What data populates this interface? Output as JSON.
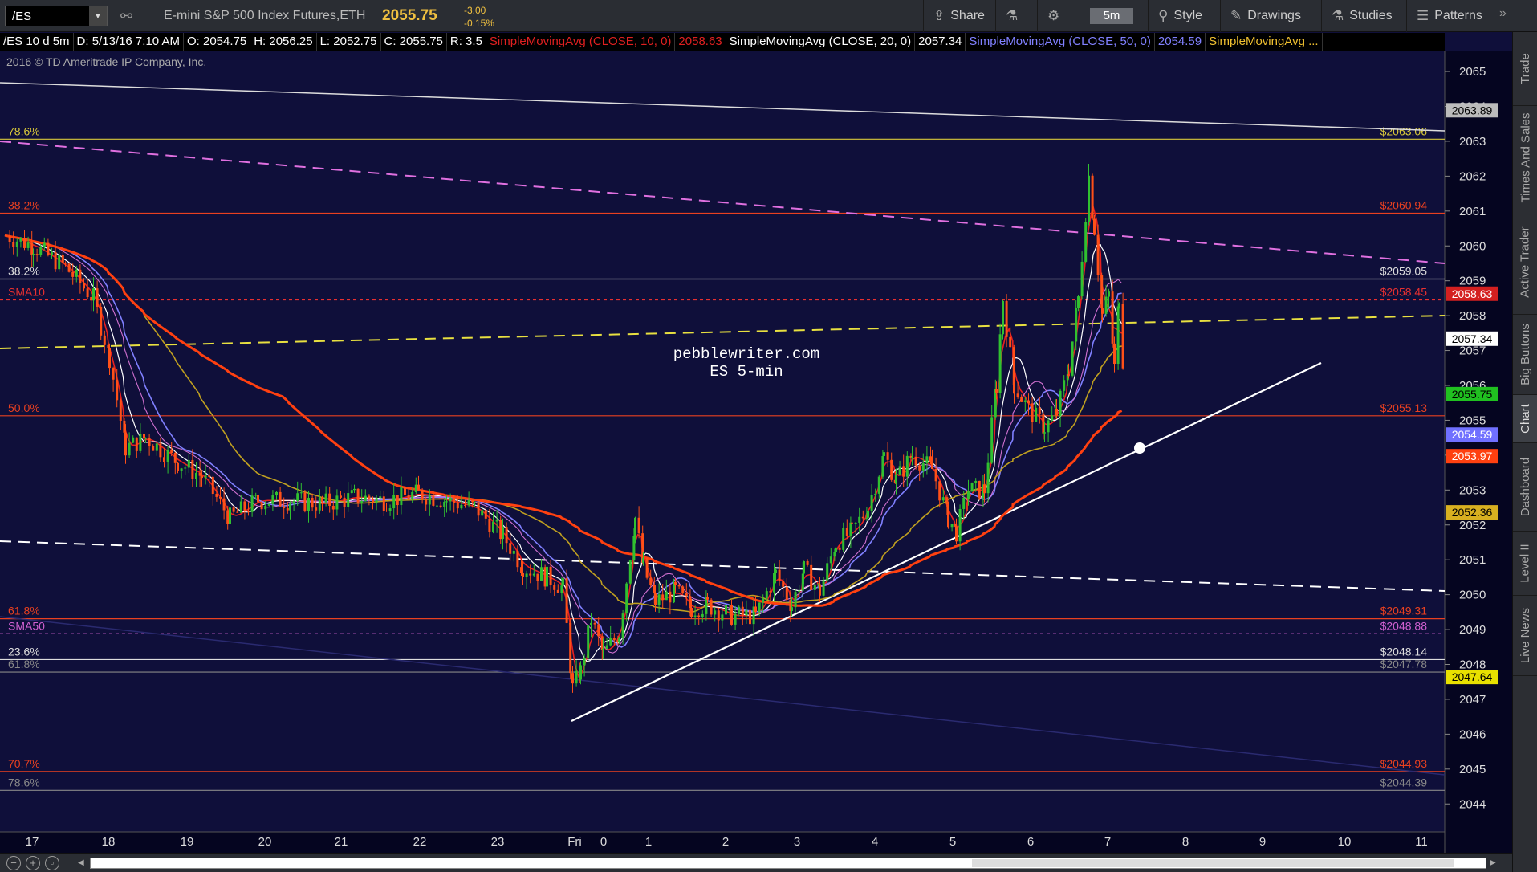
{
  "toolbar": {
    "symbol": "/ES",
    "instrument": "E-mini S&P 500 Index Futures,ETH",
    "price": "2055.75",
    "change": "-3.00",
    "change_pct": "-0.15%",
    "share": "Share",
    "timeframe": "5m",
    "style": "Style",
    "drawings": "Drawings",
    "studies": "Studies",
    "patterns": "Patterns"
  },
  "study_bar": {
    "info": "/ES 10 d 5m",
    "date": "D: 5/13/16 7:10 AM",
    "open": "O: 2054.75",
    "high": "H: 2056.25",
    "low": "L: 2052.75",
    "close": "C: 2055.75",
    "range": "R: 3.5",
    "sma10": "SimpleMovingAvg (CLOSE, 10, 0)",
    "sma10_val": "2058.63",
    "sma20": "SimpleMovingAvg (CLOSE, 20, 0)",
    "sma20_val": "2057.34",
    "sma50": "SimpleMovingAvg (CLOSE, 50, 0)",
    "sma50_val": "2054.59",
    "sma_more": "SimpleMovingAvg ..."
  },
  "copyright": "2016 © TD Ameritrade IP Company, Inc.",
  "watermark": {
    "line1": "pebblewriter.com",
    "line2": "ES 5-min"
  },
  "colors": {
    "background": "#0f0f3a",
    "sma10": "#e82020",
    "sma20": "#ffffff",
    "sma50": "#8080ff",
    "sma200": "#ff4010",
    "fib_yellow": "#d8c83a",
    "up_candle": "#30c030",
    "down_candle": "#ff5018"
  },
  "sidebar": {
    "tabs": [
      "Trade",
      "Times And Sales",
      "Active Trader",
      "Big Buttons",
      "Chart",
      "Dashboard",
      "Level II",
      "Live News"
    ],
    "active": "Chart"
  },
  "price_axis": {
    "min": 2043.2,
    "max": 2065.6,
    "ticks": [
      2044,
      2045,
      2046,
      2047,
      2048,
      2049,
      2050,
      2051,
      2052,
      2053,
      2054,
      2055,
      2056,
      2057,
      2058,
      2059,
      2060,
      2061,
      2062,
      2063,
      2064,
      2065
    ]
  },
  "time_axis": [
    "17",
    "18",
    "19",
    "20",
    "21",
    "22",
    "23",
    "Fri",
    "0",
    "1",
    "2",
    "3",
    "4",
    "5",
    "6",
    "7",
    "8",
    "9",
    "10",
    "11"
  ],
  "price_tags": [
    {
      "label": "2063.89",
      "price": 2063.89,
      "bg": "#bcbcbc",
      "fg": "#000"
    },
    {
      "label": "2058.63",
      "price": 2058.63,
      "bg": "#d42020",
      "fg": "#fff"
    },
    {
      "label": "2057.34",
      "price": 2057.34,
      "bg": "#ffffff",
      "fg": "#000"
    },
    {
      "label": "2055.75",
      "price": 2055.75,
      "bg": "#20c020",
      "fg": "#000"
    },
    {
      "label": "2054.59",
      "price": 2054.59,
      "bg": "#7070ff",
      "fg": "#fff"
    },
    {
      "label": "2053.97",
      "price": 2053.97,
      "bg": "#ff4010",
      "fg": "#fff"
    },
    {
      "label": "2052.36",
      "price": 2052.36,
      "bg": "#d8b020",
      "fg": "#000"
    },
    {
      "label": "2047.64",
      "price": 2047.64,
      "bg": "#e8e000",
      "fg": "#000"
    }
  ],
  "levels": [
    {
      "left": "78.6%",
      "right": "$2063.06",
      "price": 2063.06,
      "color": "#d8c83a",
      "dash": ""
    },
    {
      "left": "38.2%",
      "right": "$2060.94",
      "price": 2060.94,
      "color": "#e84020",
      "dash": ""
    },
    {
      "left": "38.2%",
      "right": "$2059.05",
      "price": 2059.05,
      "color": "#dddddd",
      "dash": ""
    },
    {
      "left": "SMA10",
      "right": "$2058.45",
      "price": 2058.45,
      "color": "#e83030",
      "dash": "4,4"
    },
    {
      "left": "50.0%",
      "right": "$2055.13",
      "price": 2055.13,
      "color": "#e84020",
      "dash": ""
    },
    {
      "left": "61.8%",
      "right": "$2049.31",
      "price": 2049.31,
      "color": "#e84020",
      "dash": ""
    },
    {
      "left": "SMA50",
      "right": "$2048.88",
      "price": 2048.88,
      "color": "#d060d0",
      "dash": "4,4"
    },
    {
      "left": "23.6%",
      "right": "$2048.14",
      "price": 2048.14,
      "color": "#dddddd",
      "dash": ""
    },
    {
      "left": "61.8%",
      "right": "$2047.78",
      "price": 2047.78,
      "color": "#888888",
      "dash": ""
    },
    {
      "left": "70.7%",
      "right": "$2044.93",
      "price": 2044.93,
      "color": "#e84020",
      "dash": ""
    },
    {
      "left": "78.6%",
      "right": "$2044.39",
      "price": 2044.39,
      "color": "#888888",
      "dash": ""
    }
  ]
}
